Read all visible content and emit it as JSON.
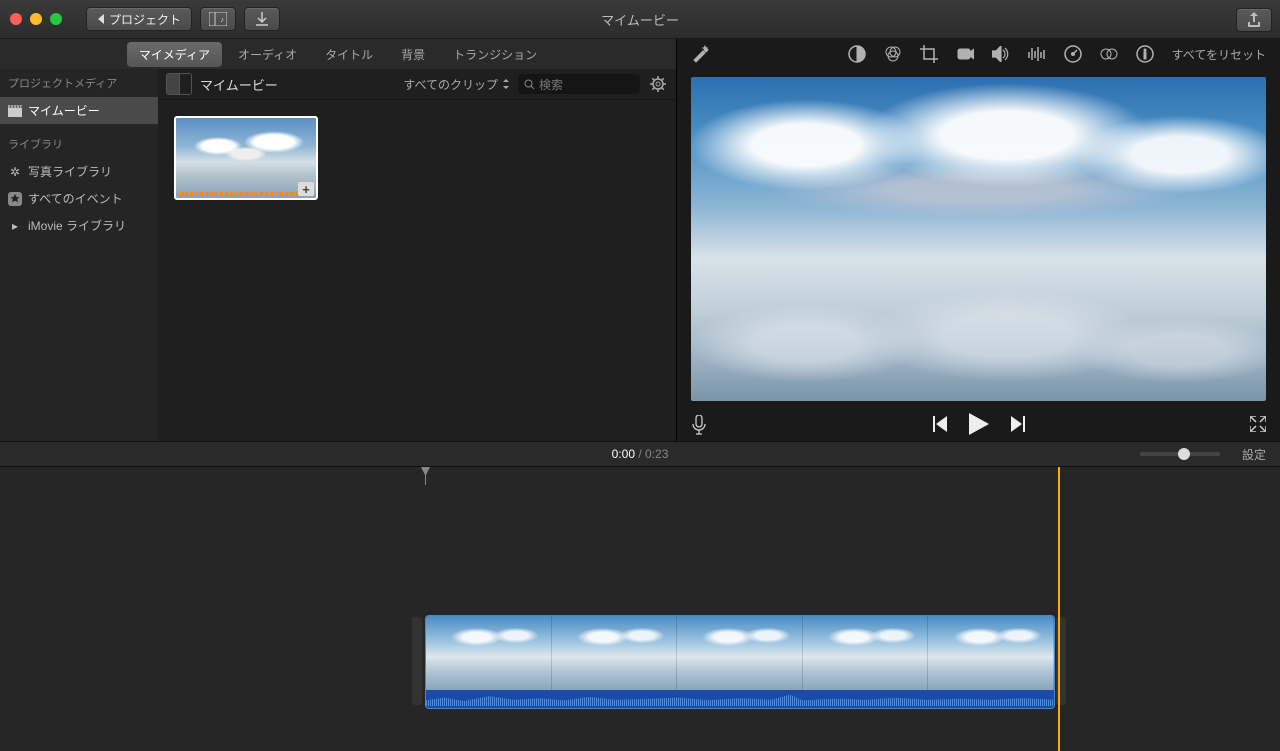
{
  "window": {
    "title": "マイムービー"
  },
  "titlebar": {
    "back_label": "プロジェクト"
  },
  "tabs": [
    {
      "label": "マイメディア",
      "active": true
    },
    {
      "label": "オーディオ",
      "active": false
    },
    {
      "label": "タイトル",
      "active": false
    },
    {
      "label": "背景",
      "active": false
    },
    {
      "label": "トランジション",
      "active": false
    }
  ],
  "sidebar": {
    "project_media_header": "プロジェクトメディア",
    "project_name": "マイムービー",
    "library_header": "ライブラリ",
    "items": [
      {
        "label": "写真ライブラリ",
        "icon": "flower"
      },
      {
        "label": "すべてのイベント",
        "icon": "star"
      },
      {
        "label": "iMovie ライブラリ",
        "icon": "disclosure"
      }
    ]
  },
  "browser": {
    "event_title": "マイムービー",
    "filter_label": "すべてのクリップ",
    "search_placeholder": "検索"
  },
  "adjust": {
    "reset_label": "すべてをリセット"
  },
  "playback": {
    "current": "0:00",
    "duration": "0:23",
    "settings_label": "設定"
  }
}
